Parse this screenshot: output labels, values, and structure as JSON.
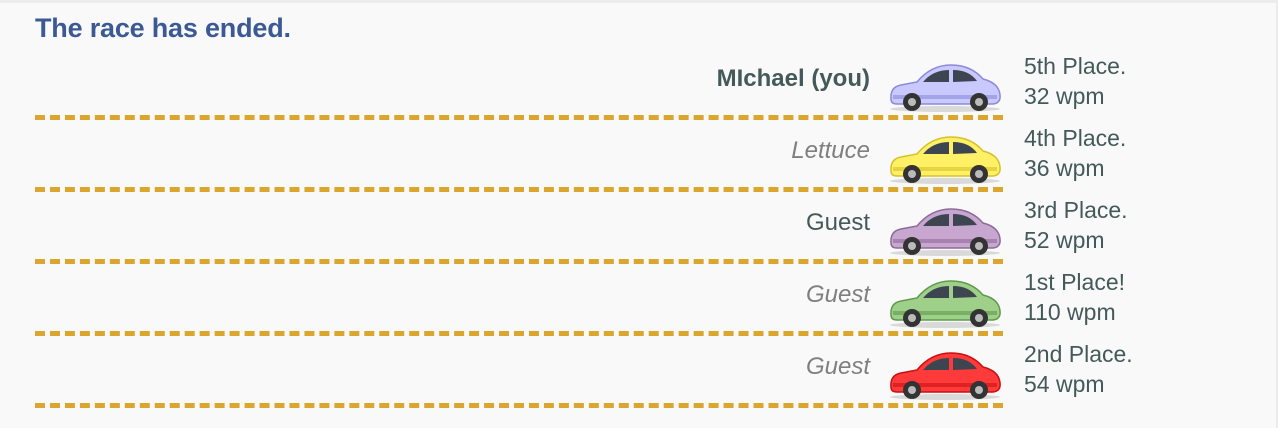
{
  "title": "The race has ended.",
  "racers": [
    {
      "name": "MIchael (you)",
      "style": "me",
      "place": "5th Place.",
      "speed": "32 wpm",
      "car_color": "#c9c9ff",
      "car_dark": "#8a8ad8"
    },
    {
      "name": "Lettuce",
      "style": "guest-italic",
      "place": "4th Place.",
      "speed": "36 wpm",
      "car_color": "#fff066",
      "car_dark": "#d6c12a"
    },
    {
      "name": "Guest",
      "style": "normal",
      "place": "3rd Place.",
      "speed": "52 wpm",
      "car_color": "#c7a6cf",
      "car_dark": "#8d6a99"
    },
    {
      "name": "Guest",
      "style": "guest-italic",
      "place": "1st Place!",
      "speed": "110 wpm",
      "car_color": "#9fd08a",
      "car_dark": "#5f9a4c"
    },
    {
      "name": "Guest",
      "style": "guest-italic",
      "place": "2nd Place.",
      "speed": "54 wpm",
      "car_color": "#ff3a3a",
      "car_dark": "#c81010"
    }
  ]
}
